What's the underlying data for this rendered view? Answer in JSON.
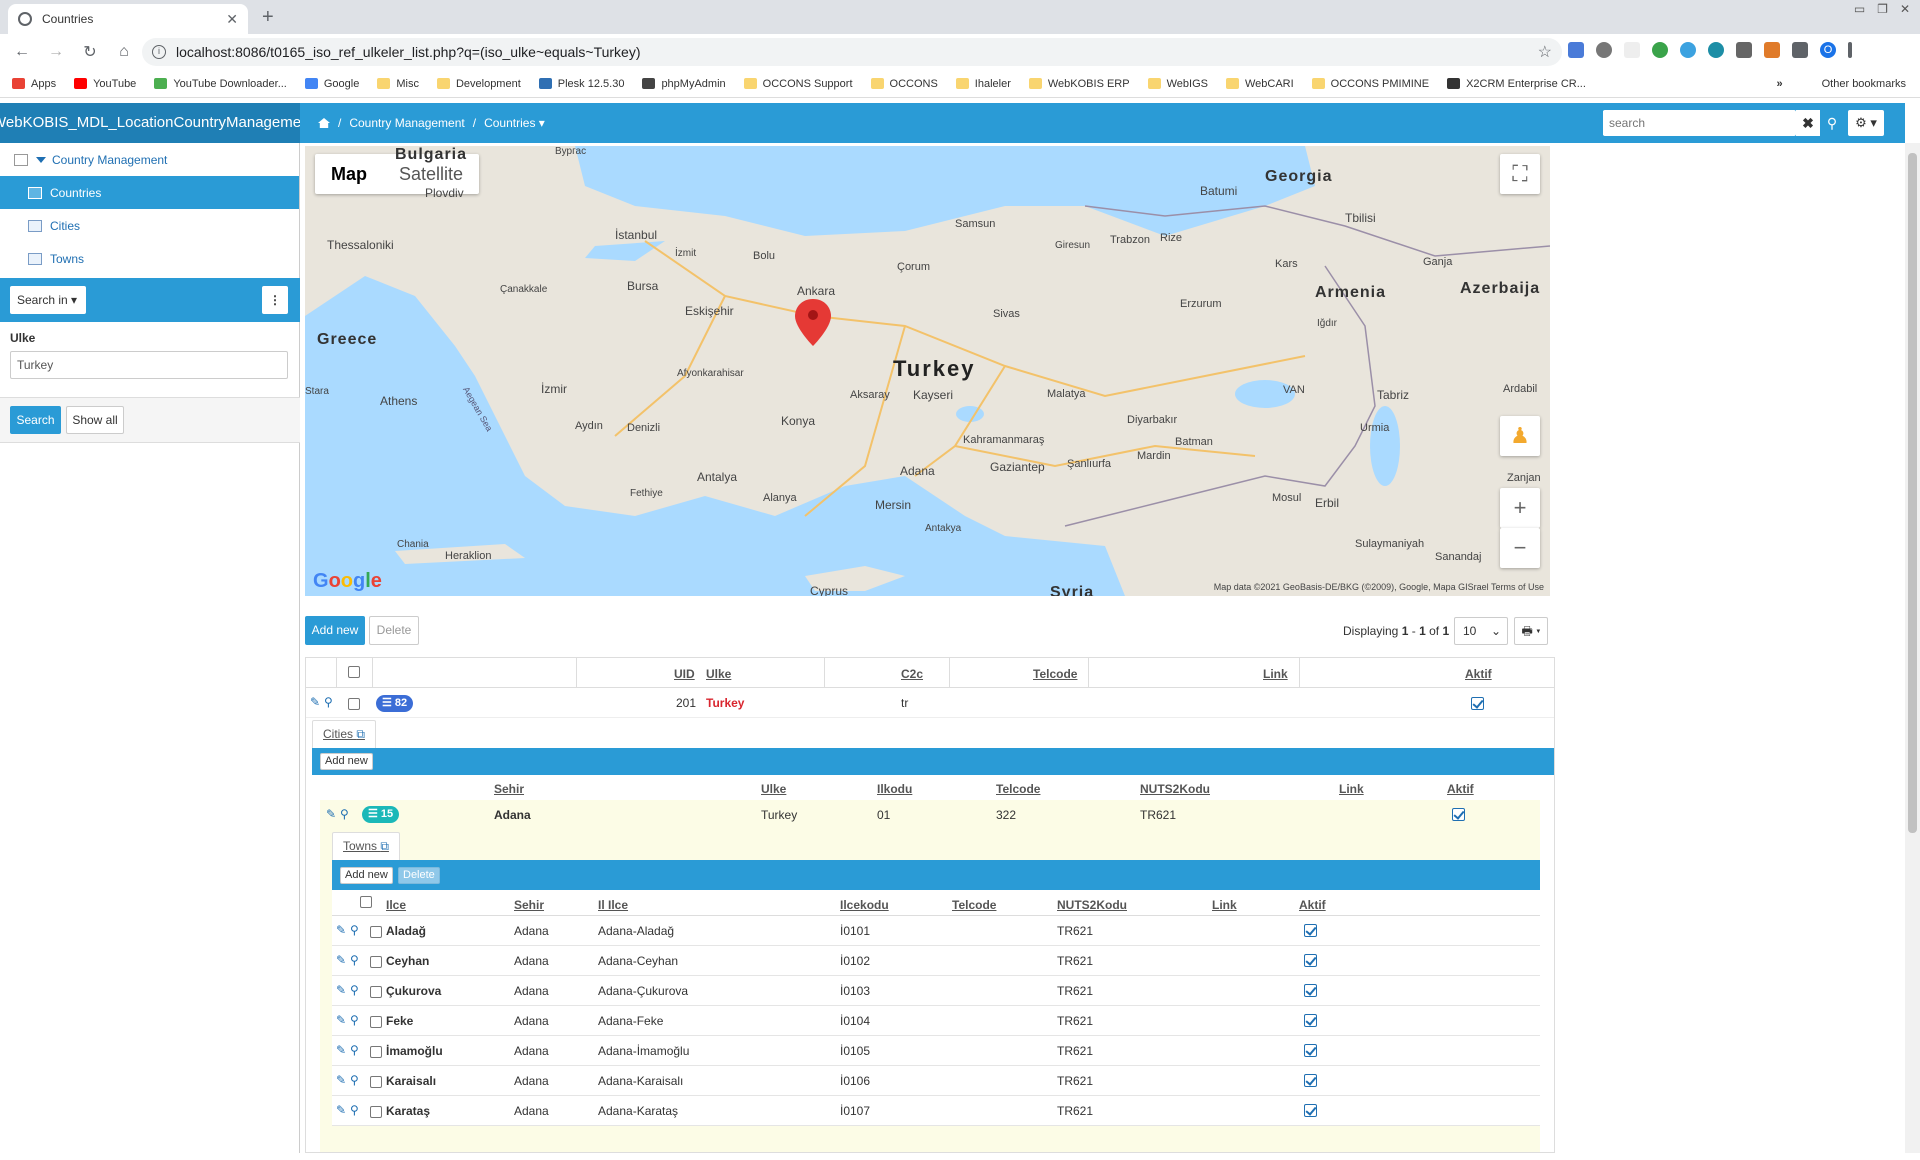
{
  "browser": {
    "tab_title": "Countries",
    "url": "localhost:8086/t0165_iso_ref_ulkeler_list.php?q=(iso_ulke~equals~Turkey)",
    "bookmarks": [
      "Apps",
      "YouTube",
      "YouTube Downloader...",
      "Google",
      "Misc",
      "Development",
      "Plesk 12.5.30",
      "phpMyAdmin",
      "OCCONS Support",
      "OCCONS",
      "Ihaleler",
      "WebKOBIS ERP",
      "WebIGS",
      "WebCARI",
      "OCCONS PMIMINE",
      "X2CRM Enterprise CR..."
    ],
    "other_bookmarks": "Other bookmarks",
    "profile_initial": "O"
  },
  "header": {
    "brand": "WebKOBIS_MDL_LocationCountryManagement",
    "breadcrumb": [
      "Country Management",
      "Countries"
    ],
    "search_placeholder": "search"
  },
  "sidebar": {
    "root": "Country Management",
    "items": [
      "Countries",
      "Cities",
      "Towns"
    ],
    "search_in": "Search in",
    "filter_label": "Ulke",
    "filter_value": "Turkey",
    "search_button": "Search",
    "show_all_button": "Show all"
  },
  "map": {
    "toggle_map": "Map",
    "toggle_satellite": "Satellite",
    "labels": {
      "bulgaria": "Bulgaria",
      "georgia": "Georgia",
      "armenia": "Armenia",
      "azerbaija": "Azerbaija",
      "greece": "Greece",
      "turkey": "Turkey",
      "syria": "Syria",
      "cyprus": "Cyprus",
      "istanbul": "İstanbul",
      "ankara": "Ankara",
      "izmir": "İzmir",
      "bursa": "Bursa",
      "eskisehir": "Eskişehir",
      "konya": "Konya",
      "antalya": "Antalya",
      "adana": "Adana",
      "mersin": "Mersin",
      "kayseri": "Kayseri",
      "gaziantep": "Gaziantep",
      "athens": "Athens",
      "thessaloniki": "Thessaloniki",
      "tbilisi": "Tbilisi",
      "tabriz": "Tabriz",
      "erbil": "Erbil",
      "samsun": "Samsun",
      "trabzon": "Trabzon",
      "erzurum": "Erzurum",
      "malatya": "Malatya",
      "sivas": "Sivas",
      "diyarbakir": "Diyarbakır",
      "van": "VAN",
      "batumi": "Batumi",
      "plovdiv": "Plovdiv",
      "denizli": "Denizli",
      "aydin": "Aydın",
      "corum": "Çorum",
      "bolu": "Bolu",
      "aksaray": "Aksaray",
      "alanya": "Alanya",
      "fethiye": "Fethiye",
      "mosul": "Mosul",
      "kahramanmaras": "Kahramanmaraş",
      "sanliurfa": "Şanlıurfa",
      "mardin": "Mardin",
      "batman": "Batman",
      "urmia": "Urmia",
      "heraklion": "Heraklion",
      "chania": "Chania",
      "aegean": "Aegean Sea",
      "kars": "Kars",
      "afyon": "Afyonkarahisar",
      "canakkale": "Çanakkale",
      "izmit": "İzmit",
      "giresun": "Giresun",
      "rize": "Rize",
      "ganja": "Ganja",
      "igdir": "Iğdır",
      "antakya": "Antakya",
      "sulaymaniyah": "Sulaymaniyah",
      "sanandaj": "Sanandaj",
      "zanjan": "Zanjan",
      "ardabil": "Ardabil",
      "burgas": "Bургас",
      "stara": "Stara"
    },
    "attribution": "Map data ©2021 GeoBasis-DE/BKG (©2009), Google, Mapa GISrael   Terms of Use",
    "google": "Google",
    "zoom_in": "+",
    "zoom_out": "−"
  },
  "toolbar": {
    "add_new": "Add new",
    "delete": "Delete",
    "displaying_prefix": "Displaying ",
    "range_start": "1",
    "range_end": "1",
    "total": "1",
    "per_page": "10"
  },
  "countries": {
    "columns": [
      "UID",
      "Ulke",
      "C2c",
      "Telcode",
      "Link",
      "Aktif"
    ],
    "row": {
      "badge": "82",
      "uid": "201",
      "ulke": "Turkey",
      "c2c": "tr",
      "telcode": "",
      "link": "",
      "aktif": true
    }
  },
  "cities": {
    "tab_label": "Cities",
    "add_new": "Add new",
    "columns": [
      "Sehir",
      "Ulke",
      "Ilkodu",
      "Telcode",
      "NUTS2Kodu",
      "Link",
      "Aktif"
    ],
    "row": {
      "badge": "15",
      "sehir": "Adana",
      "ulke": "Turkey",
      "ilkodu": "01",
      "telcode": "322",
      "nuts2": "TR621",
      "link": "",
      "aktif": true
    }
  },
  "towns": {
    "tab_label": "Towns",
    "add_new": "Add new",
    "delete": "Delete",
    "columns": [
      "Ilce",
      "Sehir",
      "Il Ilce",
      "Ilcekodu",
      "Telcode",
      "NUTS2Kodu",
      "Link",
      "Aktif"
    ],
    "rows": [
      {
        "ilce": "Aladağ",
        "sehir": "Adana",
        "ililce": "Adana-Aladağ",
        "kod": "İ0101",
        "nuts2": "TR621"
      },
      {
        "ilce": "Ceyhan",
        "sehir": "Adana",
        "ililce": "Adana-Ceyhan",
        "kod": "İ0102",
        "nuts2": "TR621"
      },
      {
        "ilce": "Çukurova",
        "sehir": "Adana",
        "ililce": "Adana-Çukurova",
        "kod": "İ0103",
        "nuts2": "TR621"
      },
      {
        "ilce": "Feke",
        "sehir": "Adana",
        "ililce": "Adana-Feke",
        "kod": "İ0104",
        "nuts2": "TR621"
      },
      {
        "ilce": "İmamoğlu",
        "sehir": "Adana",
        "ililce": "Adana-İmamoğlu",
        "kod": "İ0105",
        "nuts2": "TR621"
      },
      {
        "ilce": "Karaisalı",
        "sehir": "Adana",
        "ililce": "Adana-Karaisalı",
        "kod": "İ0106",
        "nuts2": "TR621"
      },
      {
        "ilce": "Karataş",
        "sehir": "Adana",
        "ililce": "Adana-Karataş",
        "kod": "İ0107",
        "nuts2": "TR621"
      }
    ]
  },
  "colors": {
    "primary": "#2a9bd6",
    "brand_bg": "#1f7fb5",
    "badge_blue": "#3b6dd6",
    "badge_teal": "#1bb8b8",
    "link_red": "#d9262f"
  }
}
